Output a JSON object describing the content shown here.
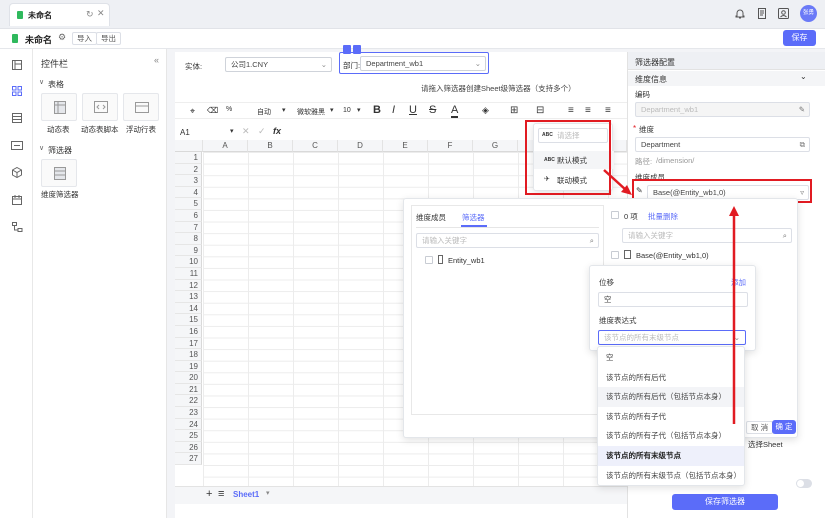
{
  "app": {
    "doc_title": "未命名",
    "import_label": "导入",
    "export_label": "导出",
    "save_label": "保存"
  },
  "widgets": {
    "title": "控件栏",
    "group_table": "表格",
    "items_table": [
      "动态表",
      "动态表脚本",
      "浮动行表"
    ],
    "group_filter": "筛选器",
    "items_filter": [
      "维度筛选器"
    ]
  },
  "filterbar": {
    "entity_label": "实体:",
    "entity_value": "公司1.CNY",
    "dept_label": "部门:",
    "dept_value": "Department_wb1",
    "hint": "请拖入筛选器创建Sheet级筛选器（支持多个）"
  },
  "ribbon": {
    "auto_label": "自动",
    "font_label": "微软雅黑",
    "size_label": "10"
  },
  "formula": {
    "cell_ref": "A1",
    "fx": "fx"
  },
  "grid": {
    "columns": [
      "A",
      "B",
      "C",
      "D",
      "E",
      "F",
      "G"
    ],
    "rows": [
      "1",
      "2",
      "3",
      "4",
      "5",
      "6",
      "7",
      "8",
      "9",
      "10",
      "11",
      "12",
      "13",
      "14",
      "15",
      "16",
      "17",
      "18",
      "19",
      "20",
      "21",
      "22",
      "23",
      "24",
      "25",
      "26",
      "27"
    ]
  },
  "sheet": {
    "tab_label": "Sheet1"
  },
  "mode_popup": {
    "placeholder": "请选择",
    "options": [
      "默认模式",
      "联动模式"
    ]
  },
  "right_panel": {
    "title": "筛选器配置",
    "section": "维度信息",
    "code_label": "编码",
    "code_value": "Department_wb1",
    "dim_label": "维度",
    "dim_value": "Department",
    "path_label": "路径:",
    "path_value": "/dimension/",
    "member_label": "维度成员",
    "member_value": "Base(@Entity_wb1,0)",
    "select_sheet": "选择Sheet",
    "save_filter_label": "保存筛选器"
  },
  "member_dialog": {
    "tab_members": "维度成员",
    "tab_filter": "筛选器",
    "search_placeholder": "请输入关键字",
    "tree_item": "Entity_wb1",
    "selected_count": "0 项",
    "batch_delete": "批量删除",
    "selected_item": "Base(@Entity_wb1,0)",
    "cancel_label": "取 消",
    "ok_label": "确 定"
  },
  "offset_popup": {
    "offset_label": "位移",
    "add_label": "添加",
    "offset_value": "空",
    "expr_label": "维度表达式",
    "expr_placeholder": "该节点的所有末级节点"
  },
  "expr_dropdown": {
    "options": [
      "空",
      "该节点的所有后代",
      "该节点的所有后代（包括节点本身）",
      "该节点的所有子代",
      "该节点的所有子代（包括节点本身）",
      "该节点的所有末级节点",
      "该节点的所有末级节点（包括节点本身）"
    ],
    "selected_index": 5
  },
  "user": {
    "avatar_text": "张勇"
  },
  "colors": {
    "accent": "#5b6cf9",
    "highlight": "#e11b22",
    "brand_green": "#2fb95d"
  }
}
